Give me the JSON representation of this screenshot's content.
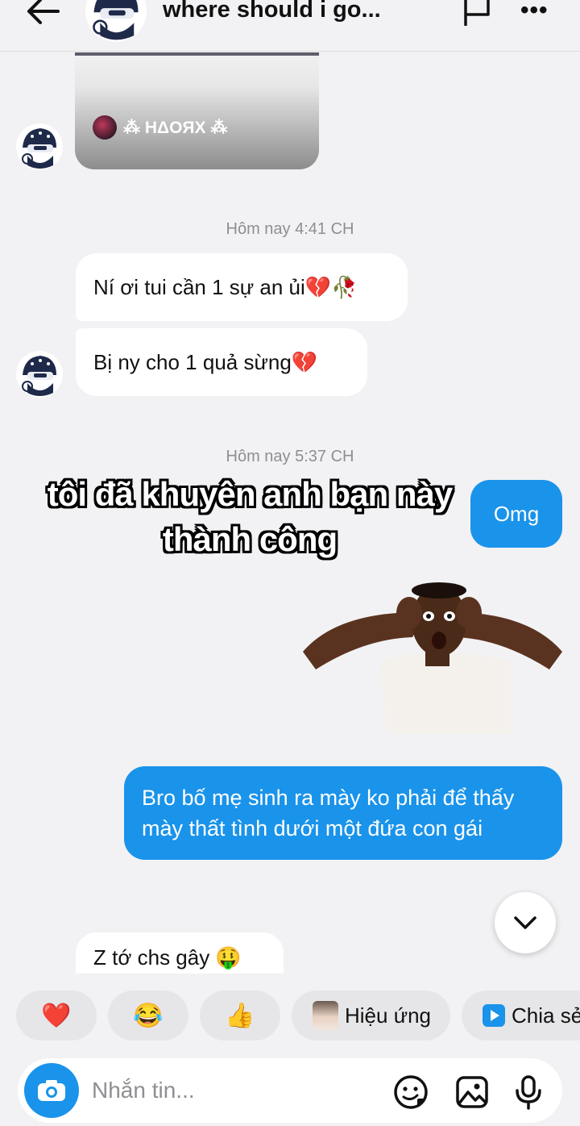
{
  "header": {
    "title": "where should i go..."
  },
  "shared_post": {
    "username": "⁂ HΔOЯX ⁂"
  },
  "messages": [
    {
      "timestamp": "Hôm nay 4:41 CH"
    },
    {
      "text": "Ní ơi tui cần 1 sự an ủi💔🥀",
      "direction": "incoming"
    },
    {
      "text": "Bị ny cho 1 quả sừng💔",
      "direction": "incoming"
    },
    {
      "timestamp": "Hôm nay 5:37 CH"
    },
    {
      "text": "Omg",
      "direction": "outgoing"
    },
    {
      "sticker": "shocked-man-hands-on-head"
    },
    {
      "text": "Bro bố mẹ sinh ra mày ko phải để thấy mày thất tình dưới một đứa con gái",
      "direction": "outgoing"
    },
    {
      "text": "Z tớ chs gây 🤑",
      "direction": "incoming"
    }
  ],
  "caption": "tôi đã khuyên anh bạn này thành công",
  "quick_reactions": {
    "heart": "❤️",
    "laugh": "😂",
    "thumbs_up": "👍",
    "effects_label": "Hiệu ứng",
    "share_label": "Chia sẻ"
  },
  "composer": {
    "placeholder": "Nhắn tin..."
  },
  "colors": {
    "outgoing_bubble": "#1a93ea",
    "incoming_bubble": "#ffffff",
    "background": "#f2f2f4"
  }
}
